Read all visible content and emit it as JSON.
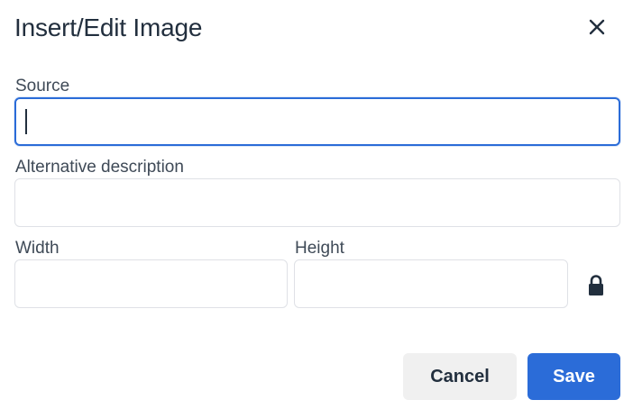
{
  "dialog": {
    "title": "Insert/Edit Image"
  },
  "fields": {
    "source": {
      "label": "Source",
      "value": ""
    },
    "alt": {
      "label": "Alternative description",
      "value": ""
    },
    "width": {
      "label": "Width",
      "value": ""
    },
    "height": {
      "label": "Height",
      "value": ""
    }
  },
  "icons": {
    "close": "close-icon",
    "lock": "lock-icon"
  },
  "buttons": {
    "cancel": "Cancel",
    "save": "Save"
  },
  "colors": {
    "accent": "#2b6cd8",
    "text": "#222f3e",
    "cancel_bg": "#f0f0f0"
  }
}
